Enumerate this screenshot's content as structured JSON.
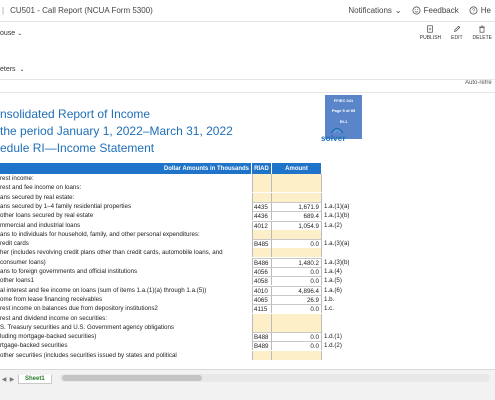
{
  "topbar": {
    "breadcrumb_sep": "|",
    "title": "CU501 - Call Report (NCUA Form 5300)",
    "notifications": "Notifications",
    "feedback": "Feedback",
    "help": "He"
  },
  "toolbar": {
    "report_label": "ouse",
    "publish": "PUBLISH",
    "edit": "EDIT",
    "delete": "DELETE"
  },
  "params": {
    "label": "eters"
  },
  "autorefresh": "Auto-refre",
  "report": {
    "title1": "nsolidated Report of Income",
    "title2": "the period January 1, 2022–March 31, 2022",
    "title3": "edule RI—Income Statement",
    "ffiec_box": [
      "FFIEC 041",
      "Page 5 of 85",
      "RI-1"
    ],
    "logo_text": "solver",
    "columns": {
      "dollar": "Dollar Amounts in Thousands",
      "riad": "RIAD",
      "amount": "Amount"
    },
    "rows": [
      {
        "desc": "rest income:",
        "riad": "",
        "amount": "",
        "ref": ""
      },
      {
        "desc": "rest and fee income on loans:",
        "riad": "",
        "amount": "",
        "ref": ""
      },
      {
        "desc": "ans secured by real estate:",
        "riad": "",
        "amount": "",
        "ref": ""
      },
      {
        "desc": "ans secured by 1–4 family residential properties",
        "riad": "4435",
        "amount": "1,671.9",
        "ref": "1.a.(1)(a)"
      },
      {
        "desc": "other loans secured by real estate",
        "riad": "4436",
        "amount": "689.4",
        "ref": "1.a.(1)(b)"
      },
      {
        "desc": "mmercial and industrial loans",
        "riad": "4012",
        "amount": "1,054.9",
        "ref": "1.a.(2)"
      },
      {
        "desc": "ans to individuals for household, family, and other personal expenditures:",
        "riad": "",
        "amount": "",
        "ref": ""
      },
      {
        "desc": "redit cards",
        "riad": "B485",
        "amount": "0.0",
        "ref": "1.a.(3)(a)"
      },
      {
        "desc": "her (includes revolving credit plans other than credit cards, automobile loans, and",
        "riad": "",
        "amount": "",
        "ref": ""
      },
      {
        "desc": "consumer loans)",
        "riad": "B486",
        "amount": "1,480.2",
        "ref": "1.a.(3)(b)"
      },
      {
        "desc": "ans to foreign governments and official institutions",
        "riad": "4056",
        "amount": "0.0",
        "ref": "1.a.(4)"
      },
      {
        "desc": "other loans1",
        "riad": "4058",
        "amount": "0.0",
        "ref": "1.a.(5)"
      },
      {
        "desc": "al interest and fee income on loans (sum of items 1.a.(1)(a) through 1.a.(5))",
        "riad": "4010",
        "amount": "4,896.4",
        "ref": "1.a.(6)"
      },
      {
        "desc": "ome from lease financing receivables",
        "riad": "4065",
        "amount": "26.9",
        "ref": "1.b."
      },
      {
        "desc": "rest income on balances due from depository institutions2",
        "riad": "4115",
        "amount": "0.0",
        "ref": "1.c."
      },
      {
        "desc": "rest and dividend income on securities:",
        "riad": "",
        "amount": "",
        "ref": ""
      },
      {
        "desc": "S. Treasury securities and U.S. Government agency obligations",
        "riad": "",
        "amount": "",
        "ref": ""
      },
      {
        "desc": "luding mortgage-backed securities)",
        "riad": "B488",
        "amount": "0.0",
        "ref": "1.d.(1)"
      },
      {
        "desc": "rtgage-backed securities",
        "riad": "B489",
        "amount": "0.0",
        "ref": "1.d.(2)"
      },
      {
        "desc": "other securities (includes securities issued by states and political",
        "riad": "",
        "amount": "",
        "ref": ""
      }
    ]
  },
  "sheet_tabs": {
    "active": "Sheet1"
  }
}
